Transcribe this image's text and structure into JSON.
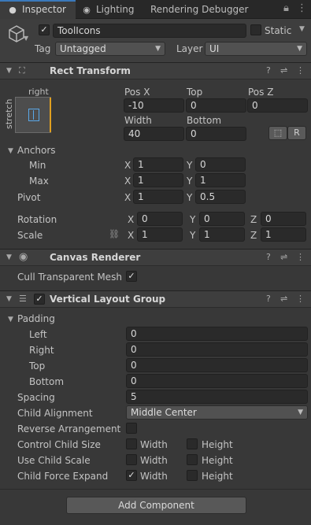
{
  "tabs": [
    {
      "label": "Inspector",
      "icon": "info-icon",
      "active": true
    },
    {
      "label": "Lighting",
      "icon": "lightbulb-icon",
      "active": false
    },
    {
      "label": "Rendering Debugger",
      "active": false
    }
  ],
  "object": {
    "name": "ToolIcons",
    "active": true,
    "static_label": "Static",
    "static_checked": false,
    "tag_label": "Tag",
    "tag_value": "Untagged",
    "layer_label": "Layer",
    "layer_value": "UI"
  },
  "rect_transform": {
    "title": "Rect Transform",
    "anchor_top_label": "right",
    "anchor_side_label": "stretch",
    "pos_x_label": "Pos X",
    "pos_x": "-10",
    "top_label": "Top",
    "top": "0",
    "pos_z_label": "Pos Z",
    "pos_z": "0",
    "width_label": "Width",
    "width": "40",
    "bottom_label": "Bottom",
    "bottom": "0",
    "blueprint_btn": "⬚",
    "raw_btn": "R",
    "anchors_label": "Anchors",
    "min_label": "Min",
    "min_x": "1",
    "min_y": "0",
    "max_label": "Max",
    "max_x": "1",
    "max_y": "1",
    "pivot_label": "Pivot",
    "pivot_x": "1",
    "pivot_y": "0.5",
    "rotation_label": "Rotation",
    "rot_x": "0",
    "rot_y": "0",
    "rot_z": "0",
    "scale_label": "Scale",
    "scale_x": "1",
    "scale_y": "1",
    "scale_z": "1",
    "x": "X",
    "y": "Y",
    "z": "Z"
  },
  "canvas_renderer": {
    "title": "Canvas Renderer",
    "cull_label": "Cull Transparent Mesh",
    "cull_checked": true
  },
  "vertical_layout": {
    "title": "Vertical Layout Group",
    "enabled": true,
    "padding_label": "Padding",
    "left_label": "Left",
    "left": "0",
    "right_label": "Right",
    "right": "0",
    "top_label": "Top",
    "top": "0",
    "bottom_label": "Bottom",
    "bottom": "0",
    "spacing_label": "Spacing",
    "spacing": "5",
    "alignment_label": "Child Alignment",
    "alignment": "Middle Center",
    "reverse_label": "Reverse Arrangement",
    "control_size_label": "Control Child Size",
    "use_scale_label": "Use Child Scale",
    "force_expand_label": "Child Force Expand",
    "width_label": "Width",
    "height_label": "Height",
    "force_expand_width": true
  },
  "add_component": "Add Component",
  "colors": {
    "accent": "#3a79bb",
    "background": "#383838",
    "field": "#2a2a2a"
  }
}
